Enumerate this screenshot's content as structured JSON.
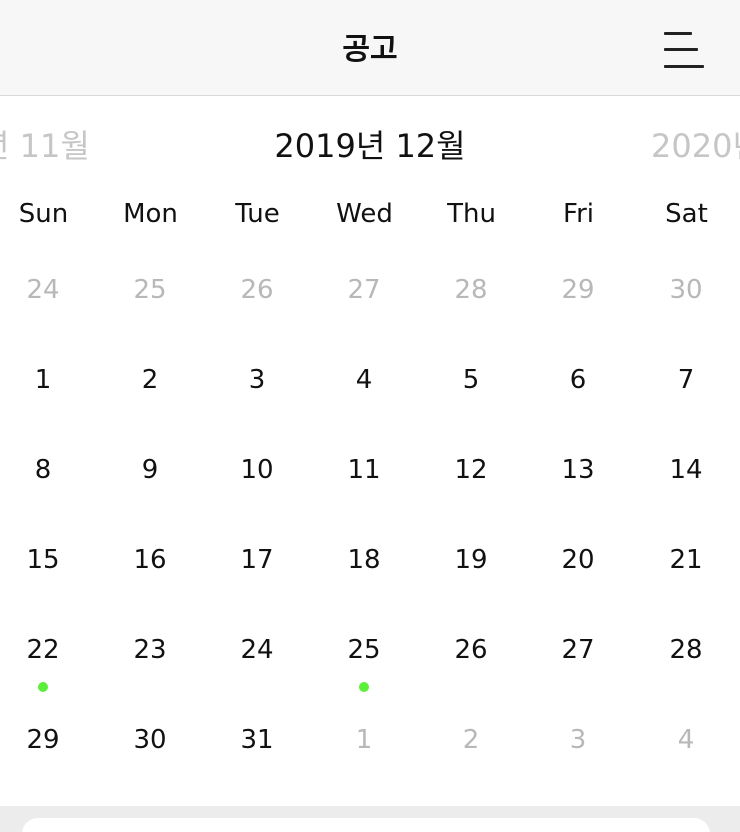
{
  "header": {
    "title": "공고",
    "menu_icon": "hamburger-menu-icon"
  },
  "month_nav": {
    "prev_label": "년 11월",
    "current_label": "2019년 12월",
    "next_label": "2020년"
  },
  "weekdays": [
    "Sun",
    "Mon",
    "Tue",
    "Wed",
    "Thu",
    "Fri",
    "Sat"
  ],
  "weeks": [
    [
      {
        "d": "24",
        "m": true
      },
      {
        "d": "25",
        "m": true
      },
      {
        "d": "26",
        "m": true
      },
      {
        "d": "27",
        "m": true
      },
      {
        "d": "28",
        "m": true
      },
      {
        "d": "29",
        "m": true
      },
      {
        "d": "30",
        "m": true
      }
    ],
    [
      {
        "d": "1"
      },
      {
        "d": "2"
      },
      {
        "d": "3"
      },
      {
        "d": "4"
      },
      {
        "d": "5"
      },
      {
        "d": "6"
      },
      {
        "d": "7"
      }
    ],
    [
      {
        "d": "8"
      },
      {
        "d": "9"
      },
      {
        "d": "10"
      },
      {
        "d": "11"
      },
      {
        "d": "12"
      },
      {
        "d": "13"
      },
      {
        "d": "14"
      }
    ],
    [
      {
        "d": "15"
      },
      {
        "d": "16"
      },
      {
        "d": "17"
      },
      {
        "d": "18"
      },
      {
        "d": "19"
      },
      {
        "d": "20"
      },
      {
        "d": "21"
      }
    ],
    [
      {
        "d": "22",
        "e": true
      },
      {
        "d": "23"
      },
      {
        "d": "24"
      },
      {
        "d": "25",
        "e": true
      },
      {
        "d": "26"
      },
      {
        "d": "27"
      },
      {
        "d": "28"
      }
    ],
    [
      {
        "d": "29"
      },
      {
        "d": "30"
      },
      {
        "d": "31"
      },
      {
        "d": "1",
        "m": true
      },
      {
        "d": "2",
        "m": true
      },
      {
        "d": "3",
        "m": true
      },
      {
        "d": "4",
        "m": true
      }
    ]
  ],
  "colors": {
    "event_dot": "#5cef3a",
    "muted_text": "#b8b8b8"
  }
}
